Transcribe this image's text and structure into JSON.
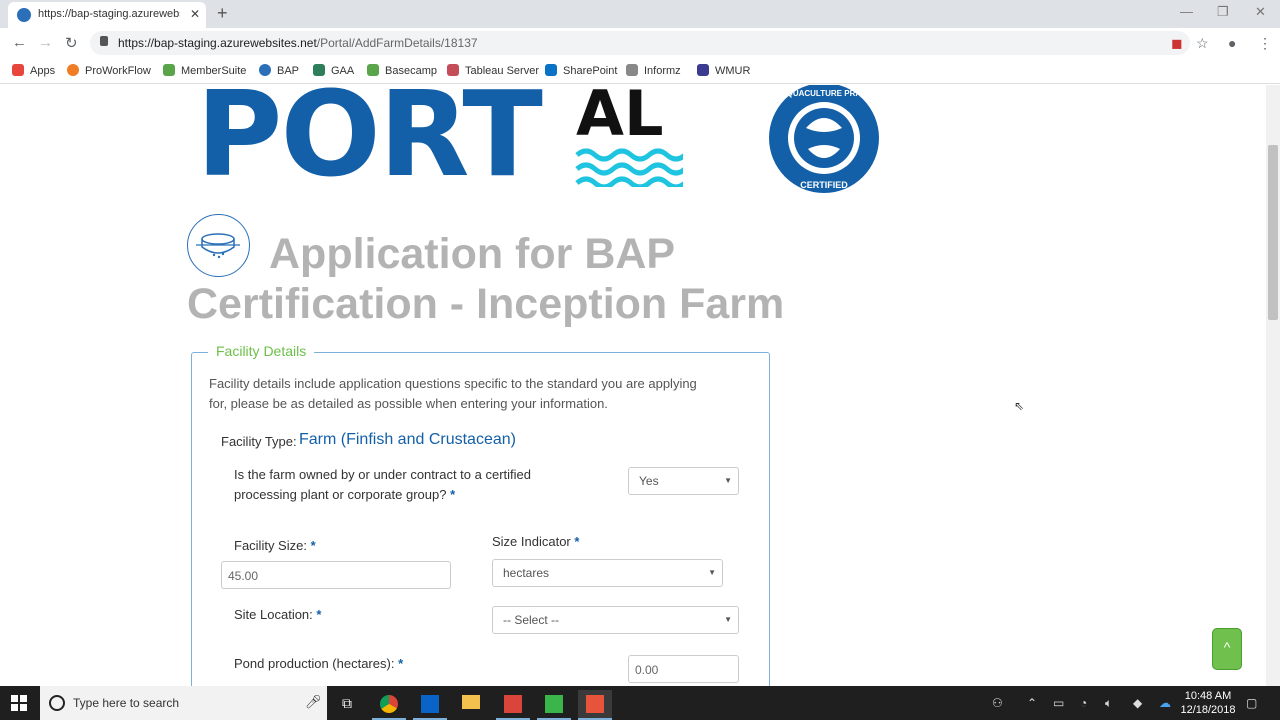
{
  "browser": {
    "tab_title": "https://bap-staging.azurewebsite",
    "url_host": "https://bap-staging.azurewebsites.net",
    "url_path": "/Portal/AddFarmDetails/18137",
    "bookmarks": [
      {
        "label": "Apps",
        "color": "#e8453c"
      },
      {
        "label": "ProWorkFlow",
        "color": "#f07c24"
      },
      {
        "label": "MemberSuite",
        "color": "#5aa54a"
      },
      {
        "label": "BAP",
        "color": "#2a6fb8"
      },
      {
        "label": "GAA",
        "color": "#2e7d5b"
      },
      {
        "label": "Basecamp",
        "color": "#59a64a"
      },
      {
        "label": "Tableau Server",
        "color": "#c44d58"
      },
      {
        "label": "SharePoint",
        "color": "#0a72c6"
      },
      {
        "label": "Informz",
        "color": "#888888"
      },
      {
        "label": "WMUR",
        "color": "#3b3b8f"
      }
    ]
  },
  "header": {
    "logo_port": "PORT",
    "logo_al": "AL",
    "seal_text": "BEST AQUACULTURE PRACTICES",
    "seal_certified": "CERTIFIED"
  },
  "page": {
    "title_line1": "Application for BAP",
    "title_line2": "Certification - Inception Farm"
  },
  "facility": {
    "legend": "Facility Details",
    "description": "Facility details include application questions specific to the standard you are applying for, please be as detailed as possible when entering your information.",
    "type_label": "Facility Type:",
    "type_value": "Farm (Finfish and Crustacean)",
    "owned_question": "Is the farm owned by or under contract to a certified processing plant or corporate group?",
    "owned_value": "Yes",
    "size_label": "Facility Size:",
    "size_value": "45.00",
    "size_indicator_label": "Size Indicator",
    "size_indicator_value": "hectares",
    "site_location_label": "Site Location:",
    "site_location_value": "-- Select --",
    "pond_label": "Pond production (hectares):",
    "pond_value": "0.00",
    "required_mark": "*"
  },
  "taskbar": {
    "search_placeholder": "Type here to search",
    "time": "10:48 AM",
    "date": "12/18/2018"
  }
}
